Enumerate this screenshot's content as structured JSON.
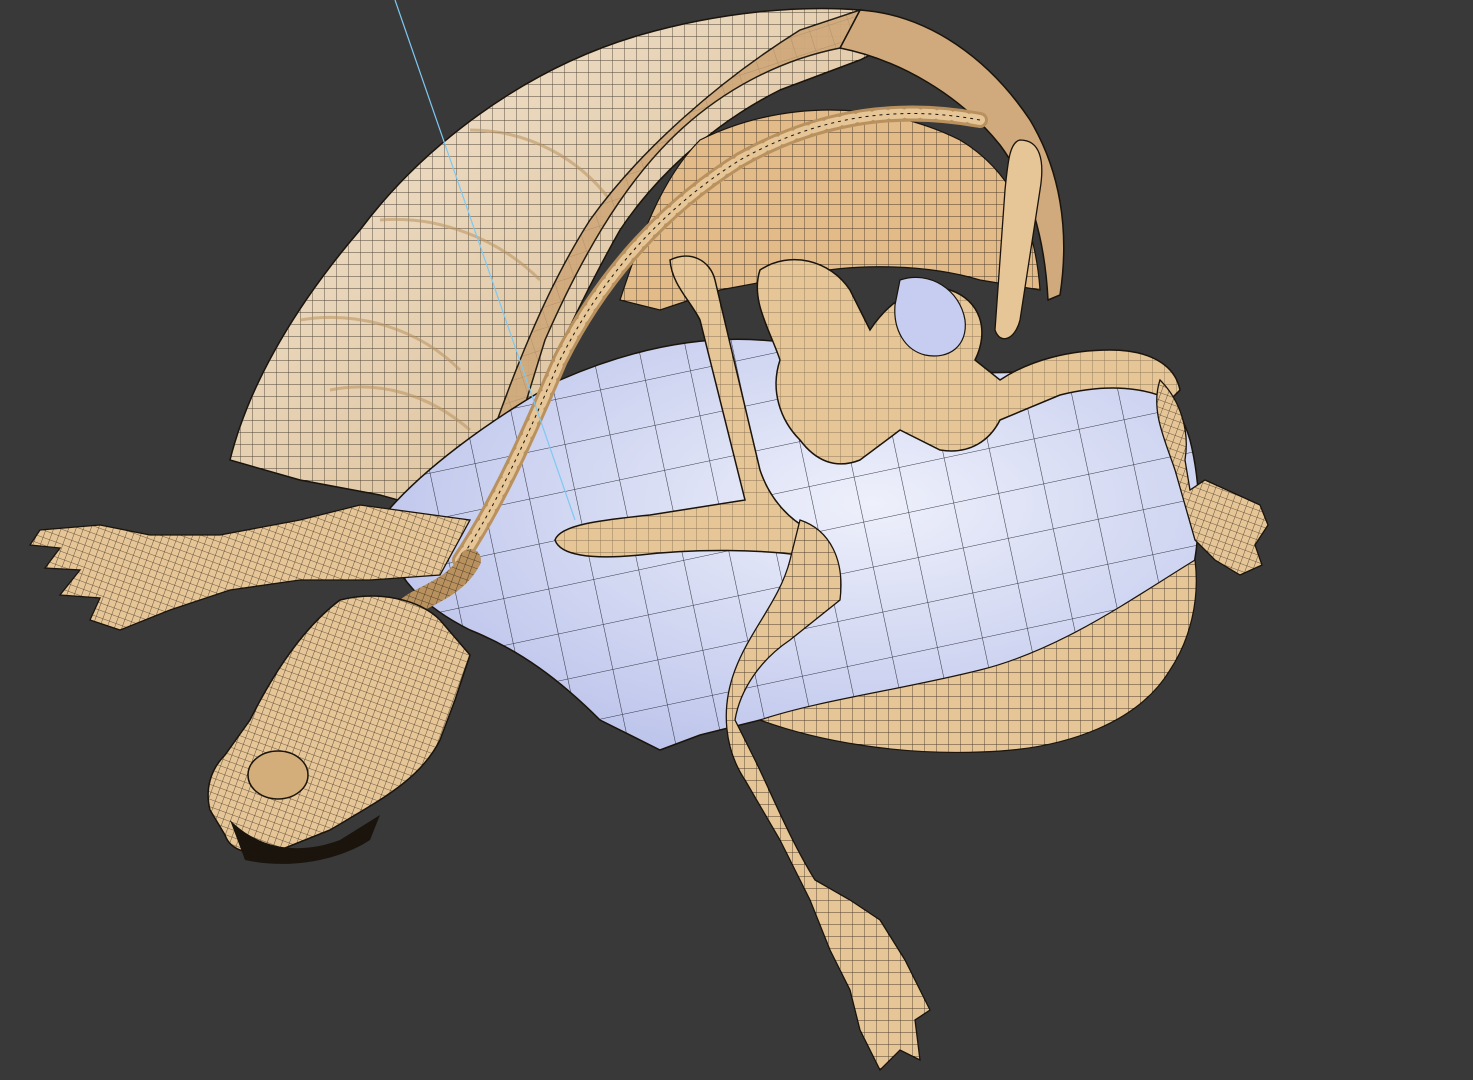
{
  "viewport": {
    "background": "#393939",
    "bone_color": "#e6c596",
    "bone_shade": "#b8915e",
    "bone_dark": "#8a6a3e",
    "shell_rim_color": "#d0aa7c",
    "plastron_color": "#c7cdf0",
    "plastron_light": "#eef0fb",
    "wire_color": "#1a140c",
    "guide_line_color": "#7fc8f2",
    "object_icon": "turtle-skeleton-mesh-icon"
  }
}
